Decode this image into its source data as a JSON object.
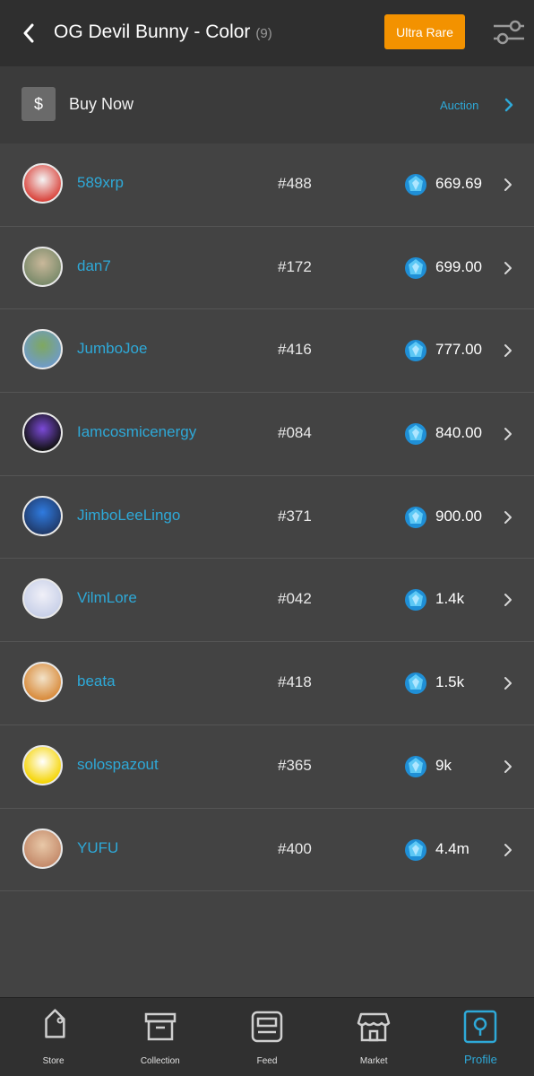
{
  "header": {
    "title": "OG Devil Bunny - Color",
    "count": "(9)",
    "rarity_label": "Ultra Rare",
    "rarity_color": "#f39200"
  },
  "subbar": {
    "buy_icon": "$",
    "buy_label": "Buy Now",
    "auction_label": "Auction"
  },
  "accent_color": "#2ea9d8",
  "listings": [
    {
      "user": "589xrp",
      "serial": "#488",
      "price": "669.69"
    },
    {
      "user": "dan7",
      "serial": "#172",
      "price": "699.00"
    },
    {
      "user": "JumboJoe",
      "serial": "#416",
      "price": "777.00"
    },
    {
      "user": "Iamcosmicenergy",
      "serial": "#084",
      "price": "840.00"
    },
    {
      "user": "JimboLeeLingo",
      "serial": "#371",
      "price": "900.00"
    },
    {
      "user": "VilmLore",
      "serial": "#042",
      "price": "1.4k"
    },
    {
      "user": "beata",
      "serial": "#418",
      "price": "1.5k"
    },
    {
      "user": "solospazout",
      "serial": "#365",
      "price": "9k"
    },
    {
      "user": "YUFU",
      "serial": "#400",
      "price": "4.4m"
    }
  ],
  "nav": [
    {
      "label": "Store",
      "icon": "tag-icon"
    },
    {
      "label": "Collection",
      "icon": "archive-box-icon"
    },
    {
      "label": "Feed",
      "icon": "feed-icon"
    },
    {
      "label": "Market",
      "icon": "market-stall-icon"
    },
    {
      "label": "Profile",
      "icon": "profile-icon",
      "active": true
    }
  ]
}
